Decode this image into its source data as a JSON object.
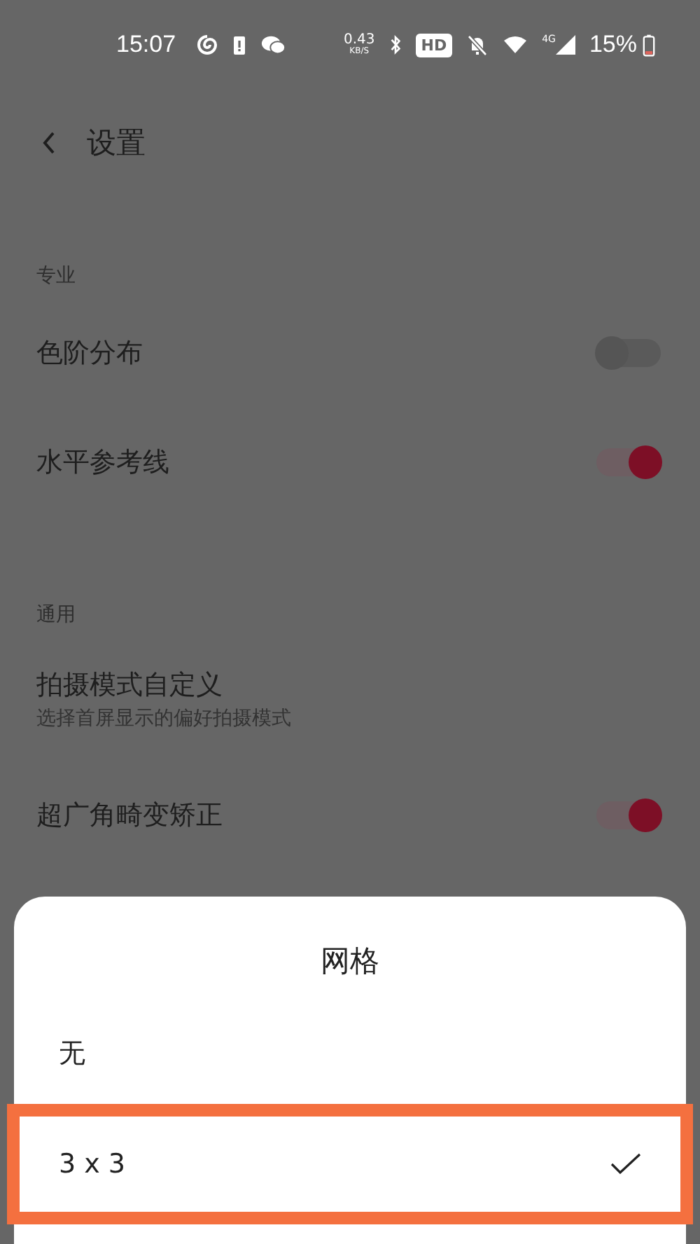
{
  "status_bar": {
    "time": "15:07",
    "net_speed": "0.43",
    "net_unit": "KB/S",
    "hd_label": "HD",
    "network_label": "4G",
    "battery": "15%"
  },
  "header": {
    "title": "设置"
  },
  "sections": [
    {
      "title": "专业",
      "items": [
        {
          "kind": "toggle",
          "label": "色阶分布",
          "on": false
        },
        {
          "kind": "toggle",
          "label": "水平参考线",
          "on": true
        }
      ]
    },
    {
      "title": "通用",
      "items": [
        {
          "kind": "nav",
          "label": "拍摄模式自定义",
          "subtitle": "选择首屏显示的偏好拍摄模式"
        },
        {
          "kind": "toggle",
          "label": "超广角畸变矫正",
          "on": true
        }
      ]
    }
  ],
  "sheet": {
    "title": "网格",
    "options": [
      {
        "label": "无",
        "selected": false,
        "highlighted": false
      },
      {
        "label": "3 x 3",
        "selected": true,
        "highlighted": true
      }
    ]
  }
}
